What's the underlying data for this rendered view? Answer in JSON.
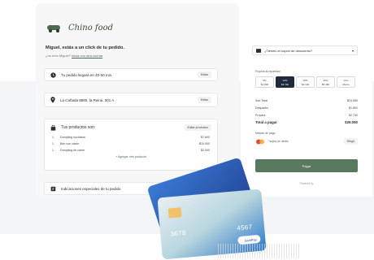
{
  "brand": {
    "name": "Chino food"
  },
  "greeting": {
    "title": "Miguel, estás a un click de tu pedido.",
    "subtitle_prefix": "¿no eres Miguel?",
    "subtitle_link": "Inicia con otra cuenta"
  },
  "delivery": {
    "eta": "Tu pedido llegará en 40-50 min.",
    "edit": "Editar"
  },
  "address": {
    "value": "La Cañada 8980, la Reina. 301 A",
    "edit": "Editar"
  },
  "products": {
    "title": "Tus productos son:",
    "edit": "Editar productos",
    "items": [
      {
        "qty": "1",
        "name": "Dumpling suchiana",
        "price": "$7.600"
      },
      {
        "qty": "1",
        "name": "Bao con carne",
        "price": "$10.000"
      },
      {
        "qty": "1",
        "name": "Dumpling de carne",
        "price": "$2.000"
      }
    ],
    "add": "+ Agregar otro producto"
  },
  "instructions": {
    "label": "Indicaciones especiales de tu pedido"
  },
  "coupon": {
    "label": "¿Tienes un cupón de descuento?"
  },
  "tips": {
    "label": "Propina al repartidor",
    "options": [
      {
        "pct": "5%",
        "amount": "$1.800"
      },
      {
        "pct": "10%",
        "amount": "$2.740"
      },
      {
        "pct": "15%",
        "amount": "$4.100"
      },
      {
        "pct": "20%",
        "amount": "$5.480"
      },
      {
        "pct": "Otro",
        "amount": "Monto"
      }
    ],
    "selected_index": 1
  },
  "totals": {
    "rows": [
      {
        "label": "Sub Total",
        "value": "$24.550"
      },
      {
        "label": "Despacho",
        "value": "$1.800"
      },
      {
        "label": "Propina",
        "value": "$2.740"
      }
    ],
    "total_label": "Total a pagar",
    "total_value": "$29.050"
  },
  "payment": {
    "label": "Método de pago",
    "method": "Tarjeta de débito",
    "change": "Elegir",
    "pay_button": "Pagar",
    "powered": "Powered by"
  },
  "credit_card": {
    "number": "4567",
    "masked": "3678",
    "brand": "JavePay"
  },
  "colors": {
    "accent": "#5a7a60",
    "selected_tip": "#1f2a3a",
    "card_blue": "#2f5fb0"
  }
}
